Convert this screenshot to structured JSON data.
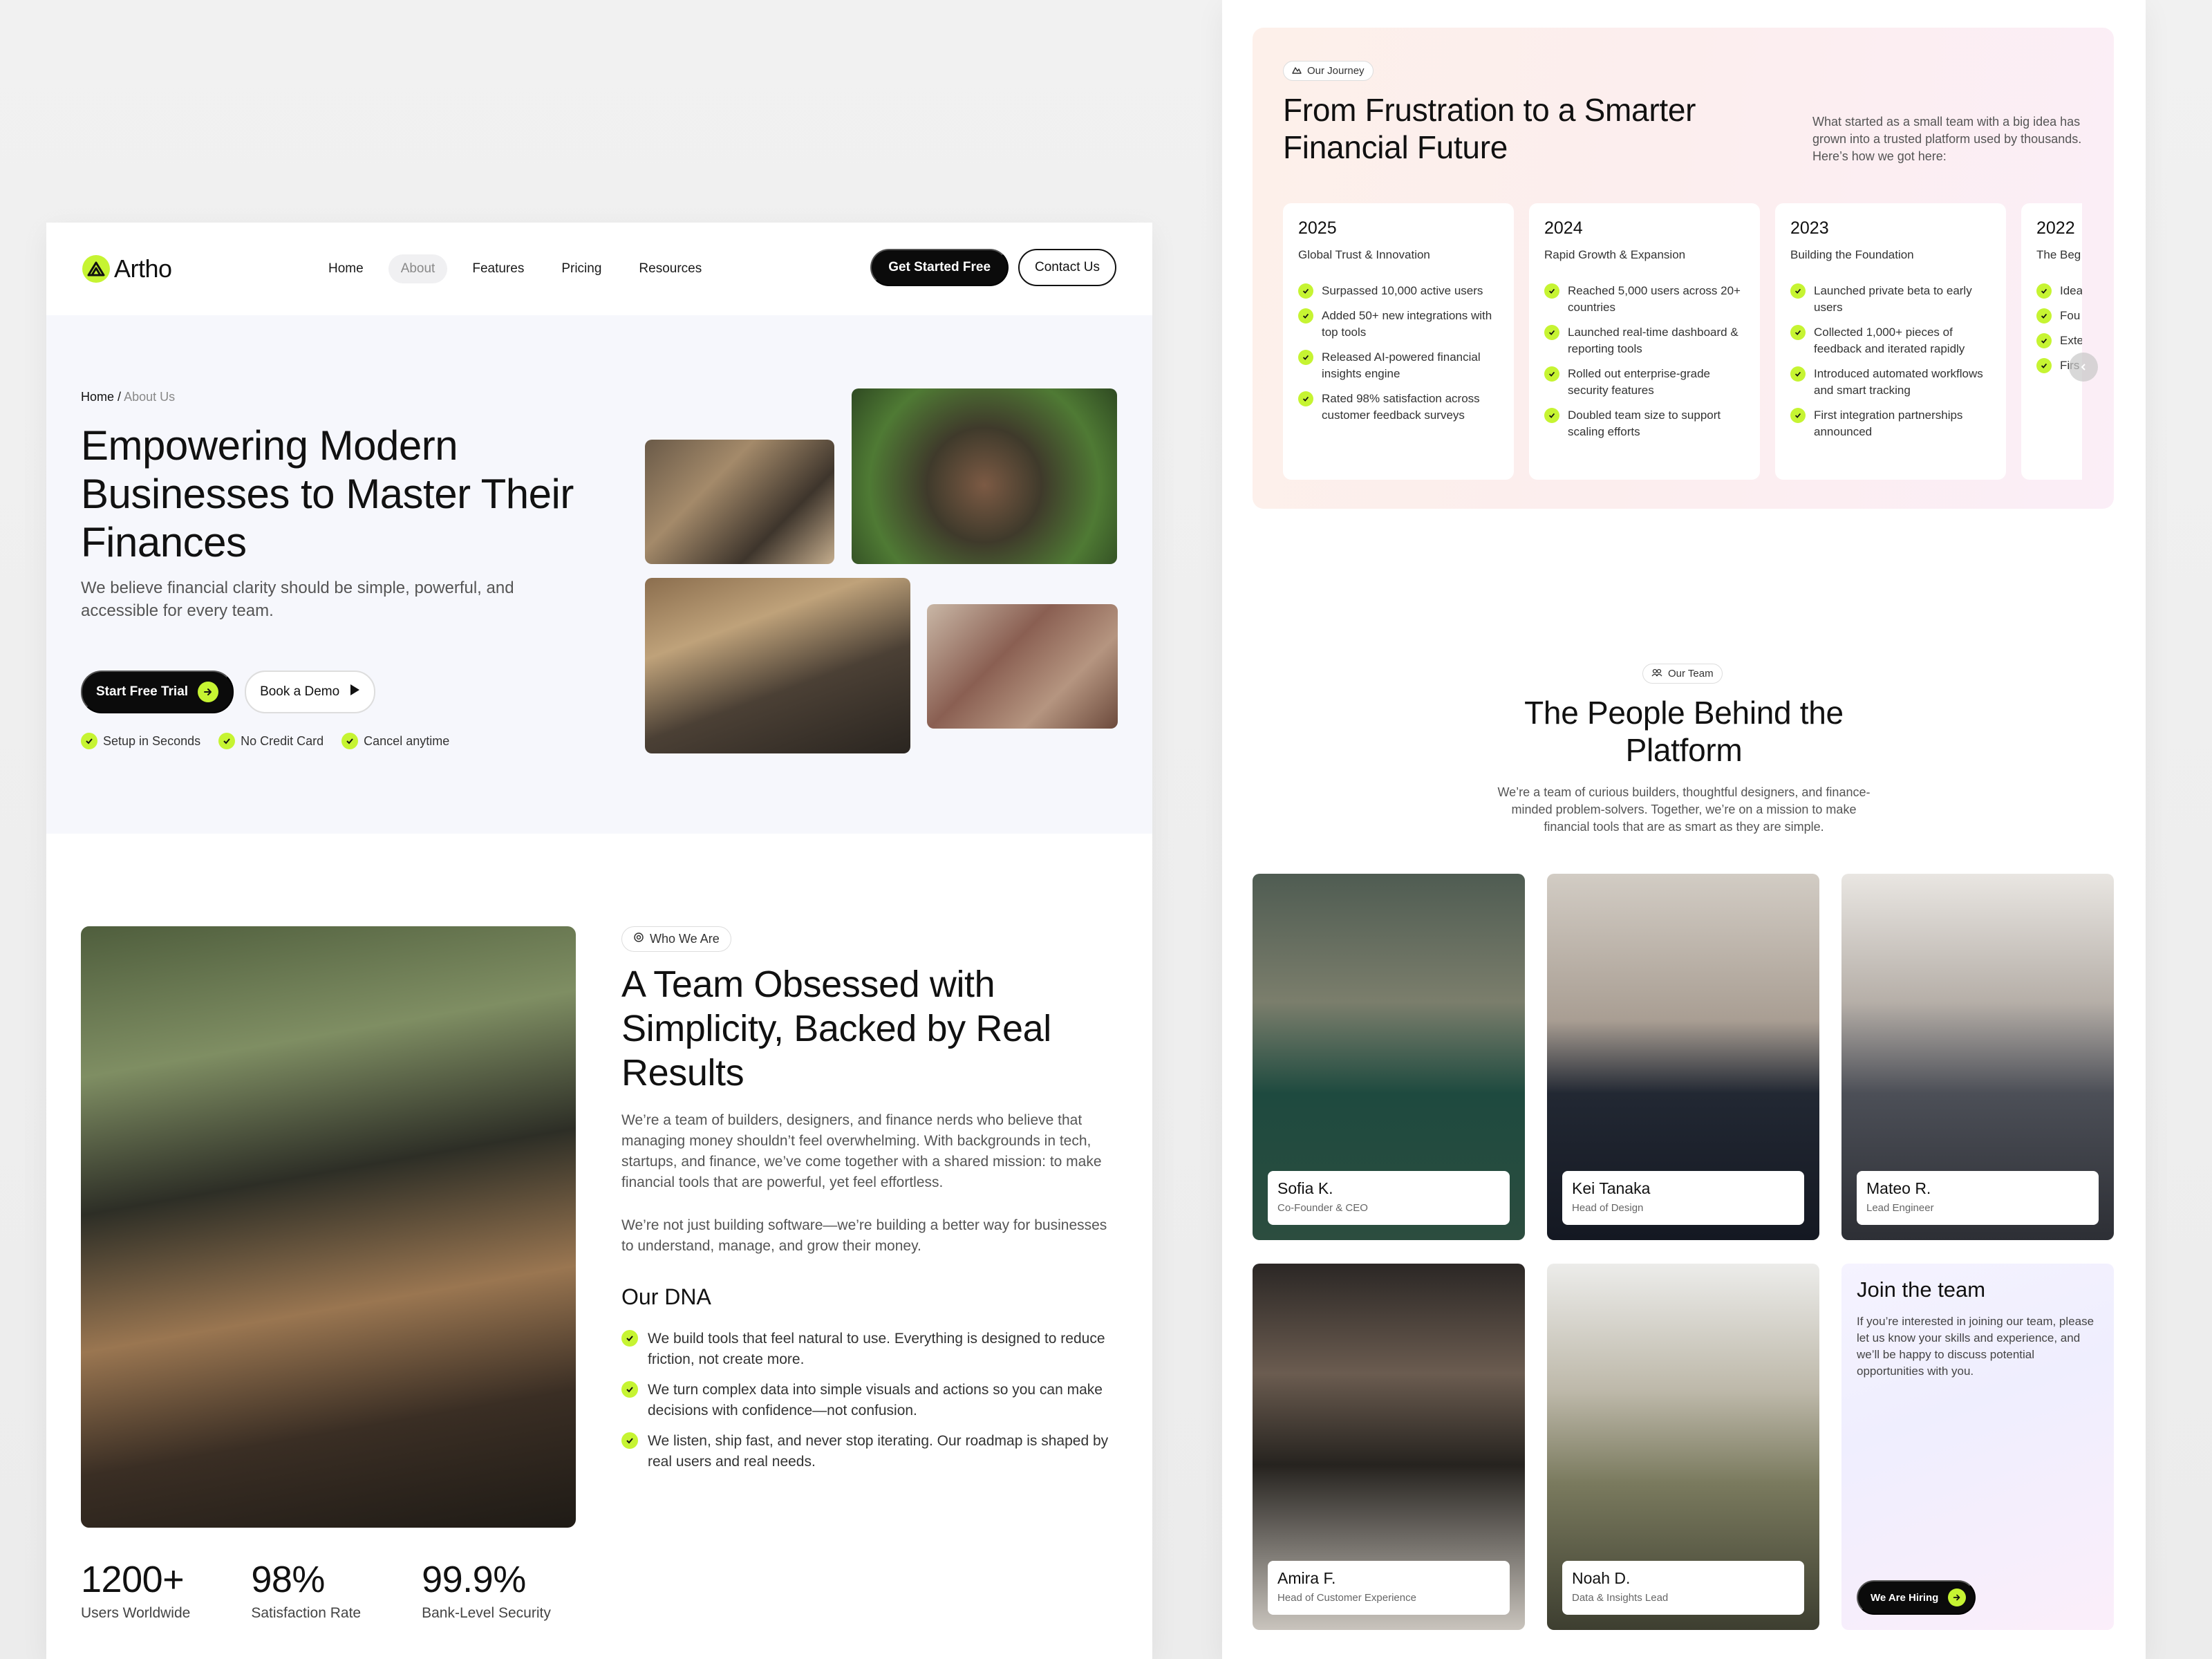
{
  "nav": {
    "logo": "Artho",
    "links": [
      "Home",
      "About",
      "Features",
      "Pricing",
      "Resources"
    ],
    "active": "About",
    "primary_cta": "Get Started Free",
    "secondary_cta": "Contact Us"
  },
  "hero": {
    "breadcrumb_home": "Home",
    "breadcrumb_sep": "/",
    "breadcrumb_current": "About Us",
    "title": "Empowering Modern Businesses to Master Their Finances",
    "subtitle": "We believe financial clarity should be simple, powerful, and accessible for every team.",
    "cta_primary": "Start Free Trial",
    "cta_secondary": "Book a Demo",
    "checks": [
      "Setup in Seconds",
      "No Credit Card",
      "Cancel anytime"
    ]
  },
  "who": {
    "pill": "Who We Are",
    "title": "A Team Obsessed with Simplicity, Backed by Real Results",
    "p1": "We’re a team of builders, designers, and finance nerds who believe that managing money shouldn’t feel overwhelming. With backgrounds in tech, startups, and finance, we’ve come together with a shared mission: to make financial tools that are powerful, yet feel effortless.",
    "p2": "We’re not just building software—we’re building a better way for businesses to understand, manage, and grow their money.",
    "dna_title": "Our DNA",
    "dna": [
      "We build tools that feel natural to use. Everything is designed to reduce friction, not create more.",
      "We turn complex data into simple visuals and actions so you can make decisions with confidence—not confusion.",
      "We listen, ship fast, and never stop iterating. Our roadmap is shaped by real users and real needs."
    ],
    "stats": [
      {
        "value": "1200+",
        "label": "Users Worldwide"
      },
      {
        "value": "98%",
        "label": "Satisfaction Rate"
      },
      {
        "value": "99.9%",
        "label": "Bank-Level Security"
      }
    ]
  },
  "journey": {
    "pill": "Our Journey",
    "title": "From Frustration to a Smarter Financial Future",
    "subtitle": "What started as a small team with a big idea has grown into a trusted platform used by thousands. Here’s how we got here:",
    "cards": [
      {
        "year": "2025",
        "theme": "Global Trust & Innovation",
        "items": [
          "Surpassed 10,000 active users",
          "Added 50+ new integrations with top tools",
          "Released AI-powered financial insights engine",
          "Rated 98% satisfaction across customer feedback surveys"
        ]
      },
      {
        "year": "2024",
        "theme": "Rapid Growth & Expansion",
        "items": [
          "Reached 5,000 users across 20+ countries",
          "Launched real-time dashboard & reporting tools",
          "Rolled out enterprise-grade security features",
          "Doubled team size to support scaling efforts"
        ]
      },
      {
        "year": "2023",
        "theme": "Building the Foundation",
        "items": [
          "Launched private beta to early users",
          "Collected 1,000+ pieces of feedback and iterated rapidly",
          "Introduced automated workflows and smart tracking",
          "First integration partnerships announced"
        ]
      },
      {
        "year": "2022",
        "theme": "The Beg",
        "items": [
          "Idea frus",
          "Fou proc exp",
          "Exte inte",
          "Firs dev"
        ]
      }
    ]
  },
  "team": {
    "pill": "Our Team",
    "title": "The People Behind the Platform",
    "subtitle": "We’re a team of curious builders, thoughtful designers, and finance-minded problem-solvers. Together, we’re on a mission to make financial tools that are as smart as they are simple.",
    "members": [
      {
        "name": "Sofia K.",
        "role": "Co-Founder & CEO"
      },
      {
        "name": "Kei Tanaka",
        "role": "Head of Design"
      },
      {
        "name": "Mateo R.",
        "role": "Lead Engineer"
      },
      {
        "name": "Amira F.",
        "role": "Head of Customer Experience"
      },
      {
        "name": "Noah D.",
        "role": "Data & Insights Lead"
      }
    ],
    "join_title": "Join the team",
    "join_text": "If you’re interested in joining our team, please let us know your skills and experience, and we’ll be happy to discuss potential opportunities with you.",
    "join_cta": "We Are Hiring"
  },
  "colors": {
    "accent": "#c6f432",
    "dark": "#0b0b0b",
    "hero_bg": "#f6f7fc"
  }
}
